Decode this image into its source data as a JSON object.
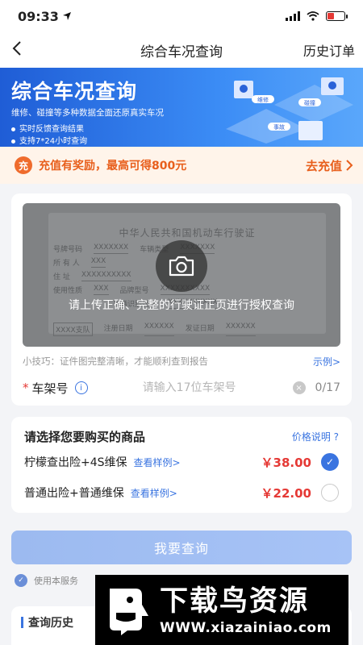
{
  "status_bar": {
    "time": "09:33"
  },
  "nav": {
    "back_icon": "chevron-left-icon",
    "title": "综合车况查询",
    "right_label": "历史订单"
  },
  "banner": {
    "title": "综合车况查询",
    "subtitle": "维修、碰撞等多种数据全面还原真实车况",
    "bullets": [
      "实时反馈查询结果",
      "支持7*24小时查询"
    ],
    "art_labels": {
      "tag1": "维修",
      "tag2": "碰撞",
      "tag3": "事故"
    }
  },
  "promo": {
    "badge": "充",
    "text": "充值有奖励，最高可得800元",
    "cta": "去充值"
  },
  "license": {
    "heading": "中华人民共和国机动车行驶证",
    "rows": [
      {
        "label": "号牌号码",
        "value": "XXXXXXX",
        "label2": "车辆类型",
        "value2": "XXXXXXX"
      },
      {
        "label": "所 有 人",
        "value": "XXX"
      },
      {
        "label": "住    址",
        "value": "XXXXXXXXXX"
      },
      {
        "label": "使用性质",
        "value": "XXX",
        "label2": "品牌型号",
        "value2": "XXXXXXXXXX"
      },
      {
        "label": "",
        "value": "",
        "label2": "车辆识别代号",
        "value2": "XXXXXXXXXX"
      },
      {
        "label": "XXXX支队",
        "value": "",
        "label2": "注册日期",
        "value2": "XXXXXX",
        "label3": "发证日期",
        "value3": "XXXXXX"
      }
    ],
    "upload_hint": "请上传正确、完整的行驶证正页进行授权查询"
  },
  "tip": {
    "text": "小技巧：证件图完整清晰，才能顺利查到报告",
    "link": "示例>"
  },
  "vin": {
    "required_mark": "*",
    "label": "车架号",
    "info": "i",
    "placeholder": "请输入17位车架号",
    "clear": "×",
    "count": "0/17"
  },
  "products": {
    "title": "请选择您要购买的商品",
    "price_note": "价格说明 ?",
    "items": [
      {
        "name": "柠檬查出险+4S维保",
        "sample": "查看样例>",
        "price": "￥38.00",
        "selected": true
      },
      {
        "name": "普通出险+普通维保",
        "sample": "查看样例>",
        "price": "￥22.00",
        "selected": false
      }
    ]
  },
  "query_button": "我要查询",
  "agreement": {
    "text": "使用本服务"
  },
  "history": {
    "title": "查询历史"
  },
  "watermark": {
    "brand": "下载鸟资源",
    "url": "WWW.xiazainiao.com"
  },
  "colors": {
    "accent": "#3a74e0",
    "price": "#e53935",
    "promo": "#e85f1c",
    "banner_start": "#1f5dd6",
    "banner_end": "#5aa7fb"
  }
}
